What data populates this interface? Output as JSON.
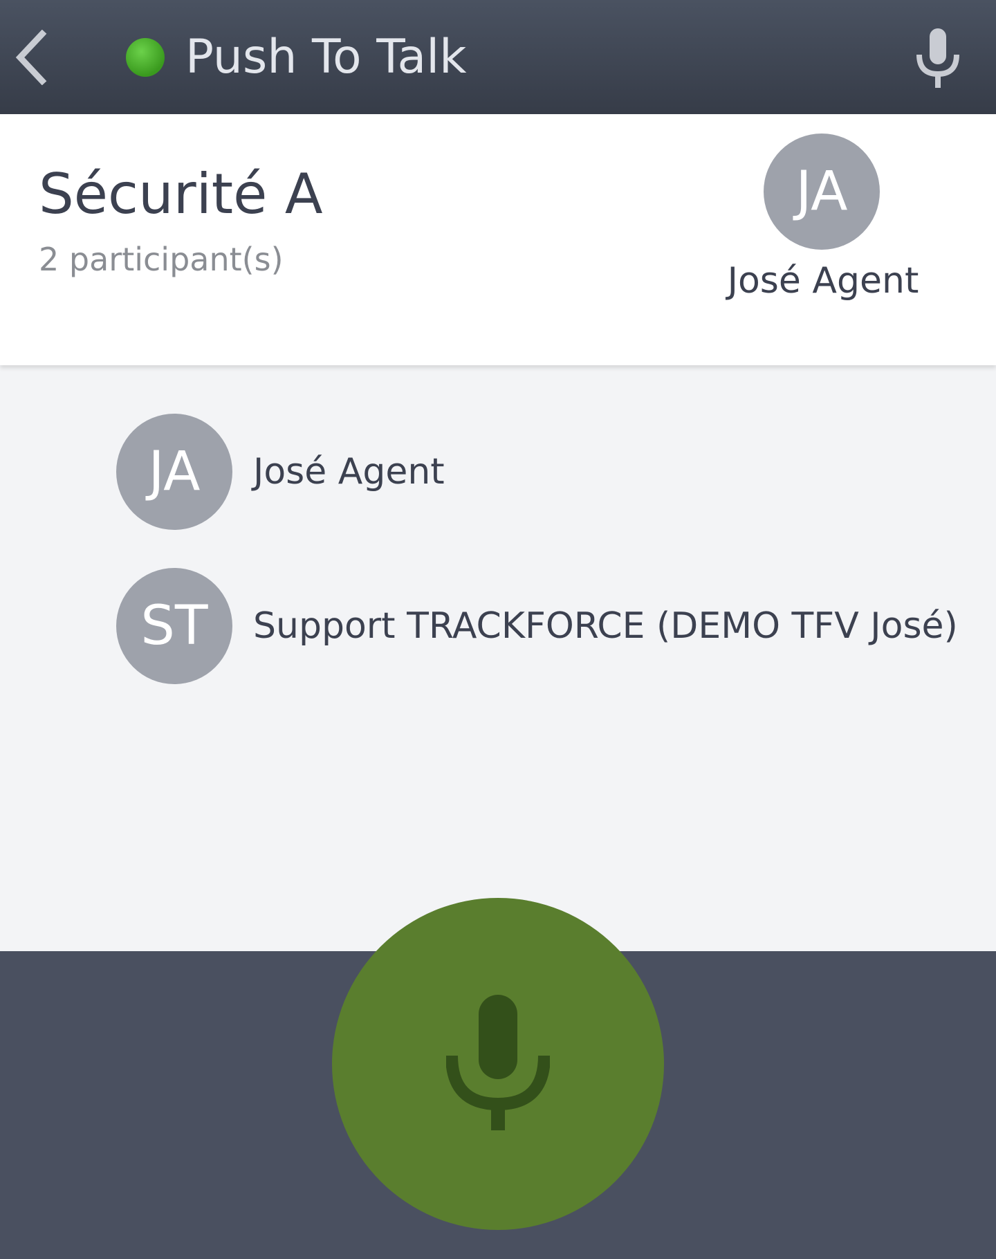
{
  "app_bar": {
    "title": "Push To Talk",
    "status_color": "#3fae24"
  },
  "channel": {
    "name": "Sécurité A",
    "participant_count_text": "2 participant(s)"
  },
  "current_speaker": {
    "initials": "JA",
    "name": "José Agent"
  },
  "participants": [
    {
      "initials": "JA",
      "name": "José Agent"
    },
    {
      "initials": "ST",
      "name": "Support TRACKFORCE (DEMO TFV José)"
    }
  ],
  "colors": {
    "accent_green": "#5a7e2e",
    "bar_dark": "#4a5060",
    "avatar_gray": "#9ea2ab"
  },
  "icons": {
    "back": "chevron-left-icon",
    "mic": "microphone-icon",
    "ptt": "microphone-icon"
  }
}
